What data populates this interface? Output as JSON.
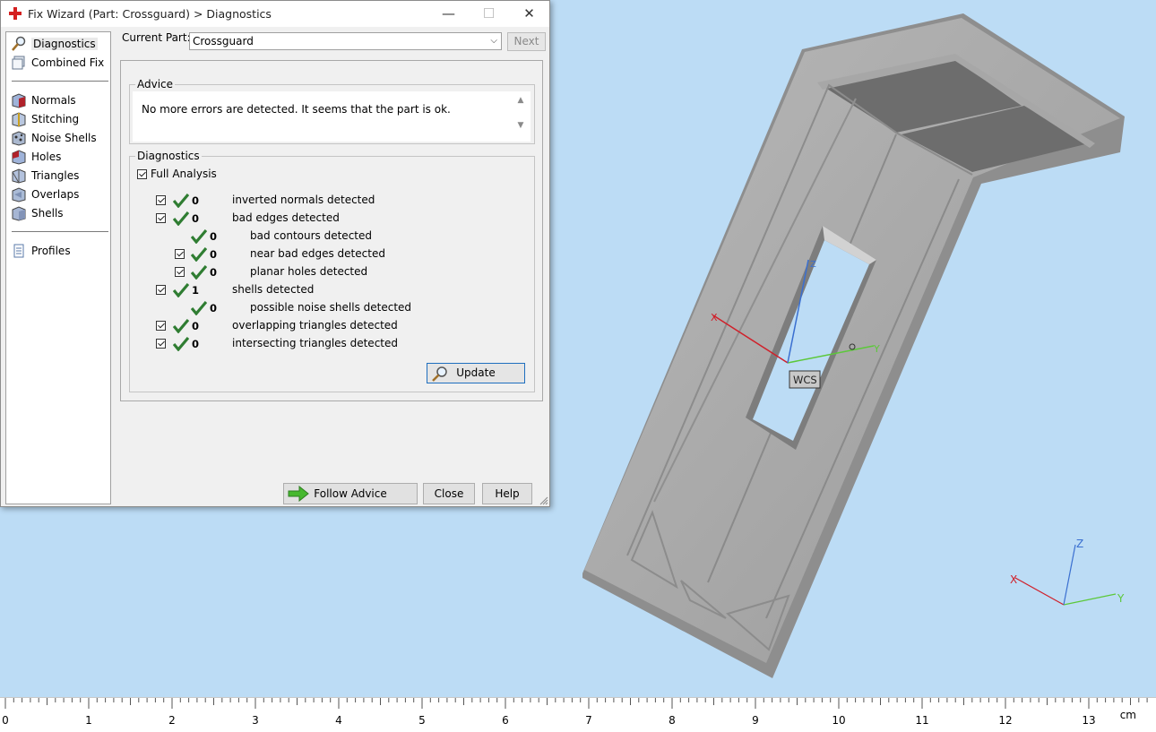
{
  "dialog": {
    "title": "Fix Wizard (Part: Crossguard) > Diagnostics",
    "minimize_label": "—",
    "maximize_label": "☐",
    "close_label": "✕"
  },
  "nav": {
    "items": [
      {
        "label": "Diagnostics",
        "icon": "magnifier-icon",
        "selected": true
      },
      {
        "label": "Combined Fix",
        "icon": "combined-fix-icon"
      },
      {
        "label": "Normals",
        "icon": "normals-icon"
      },
      {
        "label": "Stitching",
        "icon": "stitching-icon"
      },
      {
        "label": "Noise Shells",
        "icon": "noise-shells-icon"
      },
      {
        "label": "Holes",
        "icon": "holes-icon"
      },
      {
        "label": "Triangles",
        "icon": "triangles-icon"
      },
      {
        "label": "Overlaps",
        "icon": "overlaps-icon"
      },
      {
        "label": "Shells",
        "icon": "shells-icon"
      },
      {
        "label": "Profiles",
        "icon": "profiles-icon"
      }
    ]
  },
  "current_part": {
    "label": "Current Part:",
    "value": "Crossguard",
    "next_label": "Next"
  },
  "advice": {
    "legend": "Advice",
    "text": "No more errors are detected. It seems that the part is ok."
  },
  "diagnostics": {
    "legend": "Diagnostics",
    "full_analysis_label": "Full Analysis",
    "rows": [
      {
        "count": "0",
        "text": "inverted normals detected"
      },
      {
        "count": "0",
        "text": "bad edges detected"
      },
      {
        "count": "0",
        "text": "bad contours detected"
      },
      {
        "count": "0",
        "text": "near bad edges detected"
      },
      {
        "count": "0",
        "text": "planar holes detected"
      },
      {
        "count": "1",
        "text": "shells detected"
      },
      {
        "count": "0",
        "text": "possible noise shells detected"
      },
      {
        "count": "0",
        "text": "overlapping triangles detected"
      },
      {
        "count": "0",
        "text": "intersecting triangles detected"
      }
    ],
    "update_label": "Update"
  },
  "buttons": {
    "follow_advice": "Follow Advice",
    "close": "Close",
    "help": "Help"
  },
  "viewport": {
    "wcs_label": "WCS",
    "axis_x": "X",
    "axis_y": "Y",
    "axis_z": "Z",
    "axis_x_color": "#d0202a",
    "axis_y_color": "#5cc83a",
    "axis_z_color": "#3a6fd0"
  },
  "ruler": {
    "ticks": [
      "0",
      "1",
      "2",
      "3",
      "4",
      "5",
      "6",
      "7",
      "8",
      "9",
      "10",
      "11",
      "12",
      "13"
    ],
    "unit": "cm"
  }
}
